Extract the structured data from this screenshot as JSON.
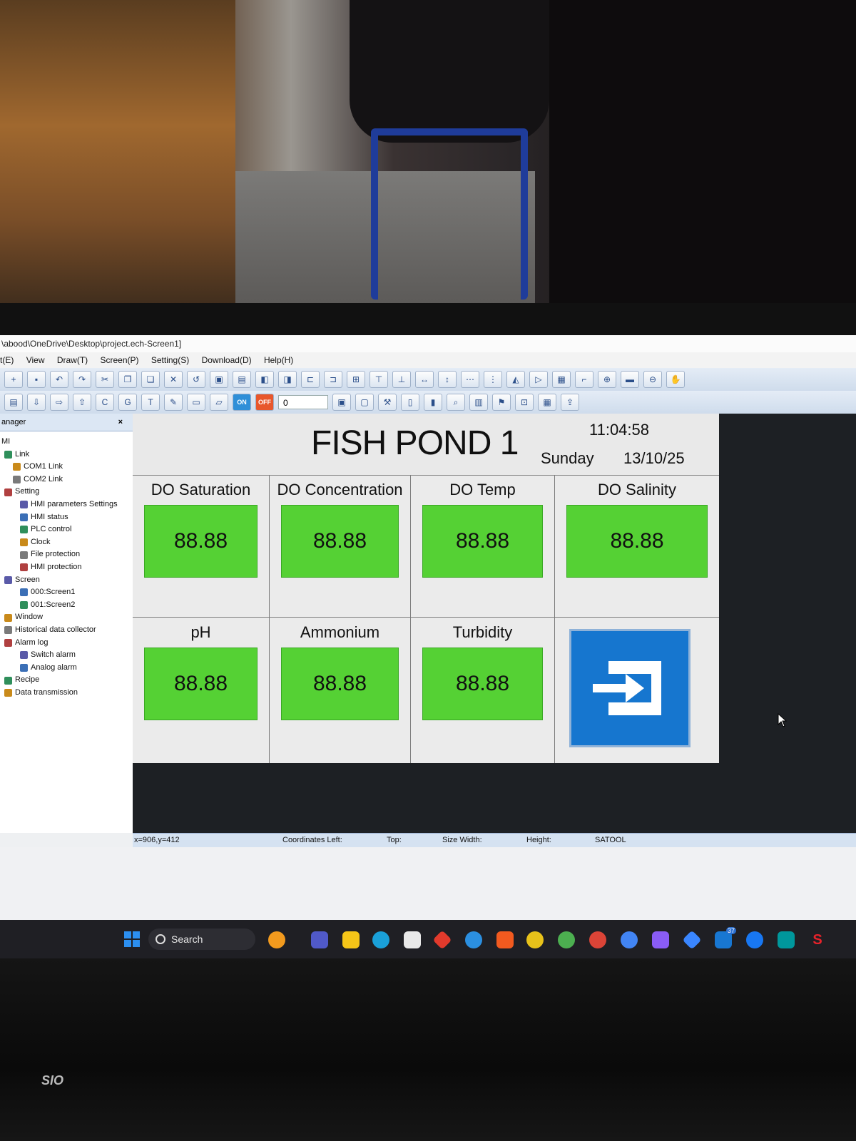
{
  "window": {
    "title": "\\abood\\OneDrive\\Desktop\\project.ech-Screen1]"
  },
  "menu": {
    "items": [
      "t(E)",
      "View",
      "Draw(T)",
      "Screen(P)",
      "Setting(S)",
      "Download(D)",
      "Help(H)"
    ]
  },
  "toolbar": {
    "on_label": "ON",
    "off_label": "OFF",
    "select_value": "0"
  },
  "manager": {
    "tab_label": "anager",
    "close_label": "×",
    "tree": [
      {
        "label": "MI",
        "level": 0
      },
      {
        "label": "Link",
        "level": 1
      },
      {
        "label": "COM1 Link",
        "level": 2
      },
      {
        "label": "COM2 Link",
        "level": 2
      },
      {
        "label": "Setting",
        "level": 1
      },
      {
        "label": "HMI parameters Settings",
        "level": 3
      },
      {
        "label": "HMI status",
        "level": 3
      },
      {
        "label": "PLC control",
        "level": 3
      },
      {
        "label": "Clock",
        "level": 3
      },
      {
        "label": "File protection",
        "level": 3
      },
      {
        "label": "HMI protection",
        "level": 3
      },
      {
        "label": "Screen",
        "level": 1
      },
      {
        "label": "000:Screen1",
        "level": 3
      },
      {
        "label": "001:Screen2",
        "level": 3
      },
      {
        "label": "Window",
        "level": 1
      },
      {
        "label": "Historical data collector",
        "level": 1
      },
      {
        "label": "Alarm log",
        "level": 1
      },
      {
        "label": "Switch alarm",
        "level": 3
      },
      {
        "label": "Analog alarm",
        "level": 3
      },
      {
        "label": "Recipe",
        "level": 1
      },
      {
        "label": "Data transmission",
        "level": 1
      }
    ]
  },
  "hmi": {
    "title": "FISH POND 1",
    "time": "11:04:58",
    "day": "Sunday",
    "date": "13/10/25",
    "cells": [
      {
        "label": "DO Saturation",
        "value": "88.88"
      },
      {
        "label": "DO Concentration",
        "value": "88.88"
      },
      {
        "label": "DO Temp",
        "value": "88.88"
      },
      {
        "label": "DO Salinity",
        "value": "88.88"
      },
      {
        "label": "pH",
        "value": "88.88"
      },
      {
        "label": "Ammonium",
        "value": "88.88"
      },
      {
        "label": "Turbidity",
        "value": "88.88"
      }
    ],
    "value_color": "#55d134",
    "exit_button_color": "#1676cf"
  },
  "status": {
    "cursor": "x=906,y=412",
    "coordinates_label": "Coordinates Left:",
    "top_label": "Top:",
    "size_label": "Size Width:",
    "height_label": "Height:",
    "tool": "SATOOL"
  },
  "taskbar": {
    "search_label": "Search",
    "badge": "37"
  },
  "laptop": {
    "logo": "SIO"
  }
}
